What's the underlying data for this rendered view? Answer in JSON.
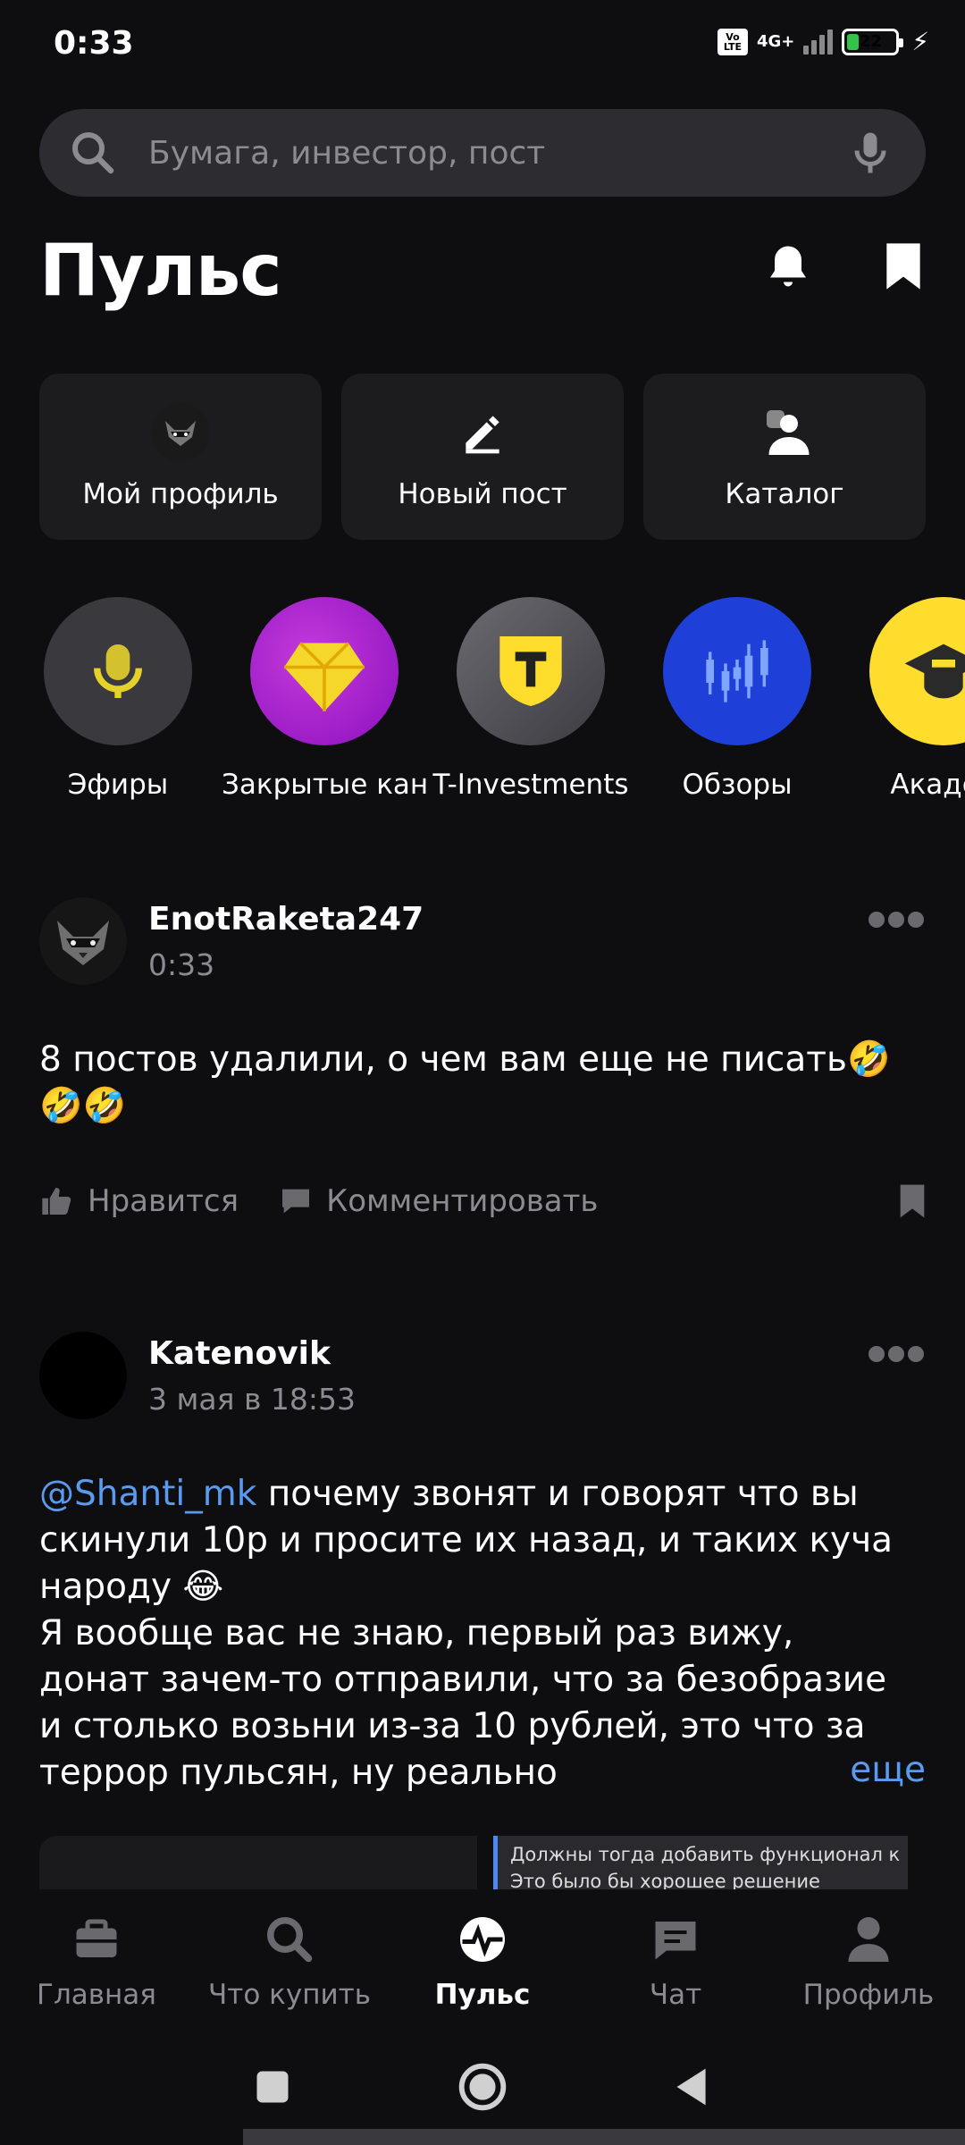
{
  "status_bar": {
    "time": "0:33",
    "volte": "Vo LTE",
    "network": "4G+",
    "battery": "22"
  },
  "search": {
    "placeholder": "Бумага, инвестор, пост"
  },
  "header": {
    "title": "Пульс"
  },
  "quick_actions": [
    {
      "label": "Мой профиль",
      "icon": "avatar"
    },
    {
      "label": "Новый пост",
      "icon": "pencil-icon"
    },
    {
      "label": "Каталог",
      "icon": "people-icon"
    }
  ],
  "stories": [
    {
      "label": "Эфиры",
      "icon": "microphone-icon"
    },
    {
      "label": "Закрытые кан",
      "icon": "gem-icon"
    },
    {
      "label": "T-Investments",
      "icon": "t-shield-icon"
    },
    {
      "label": "Обзоры",
      "icon": "candles-icon"
    },
    {
      "label": "Акадел",
      "icon": "graduation-cap-icon"
    }
  ],
  "posts": [
    {
      "author": "EnotRaketa247",
      "date": "0:33",
      "text": "8 постов удалили, о чем вам еще не писать🤣🤣🤣",
      "like_label": "Нравится",
      "comment_label": "Комментировать"
    },
    {
      "author": "Katenovik",
      "date": "3 мая в 18:53",
      "mention": "@Shanti_mk",
      "text": " почему звонят и говорят что вы скинули 10р и просите их назад, и таких куча народу 😂\nЯ вообще вас не знаю, первый раз вижу, донат зачем-то отправили, что за безобразие и столько возьни из-за 10 рублей, это что за террор пульсян, ну реально",
      "more": "еще",
      "preview_lines": [
        "Должны тогда добавить функционал к",
        "Это было бы хорошее решение"
      ]
    }
  ],
  "bottom_nav": [
    {
      "label": "Главная",
      "icon": "briefcase-icon"
    },
    {
      "label": "Что купить",
      "icon": "search-icon"
    },
    {
      "label": "Пульс",
      "icon": "pulse-icon",
      "active": true
    },
    {
      "label": "Чат",
      "icon": "chat-icon"
    },
    {
      "label": "Профиль",
      "icon": "profile-icon"
    }
  ],
  "colors": {
    "background": "#0e0e10",
    "card": "#1c1c1f",
    "accent_link": "#5a9bf0",
    "muted": "#8b8b90",
    "brand_yellow": "#ffdd2d"
  }
}
